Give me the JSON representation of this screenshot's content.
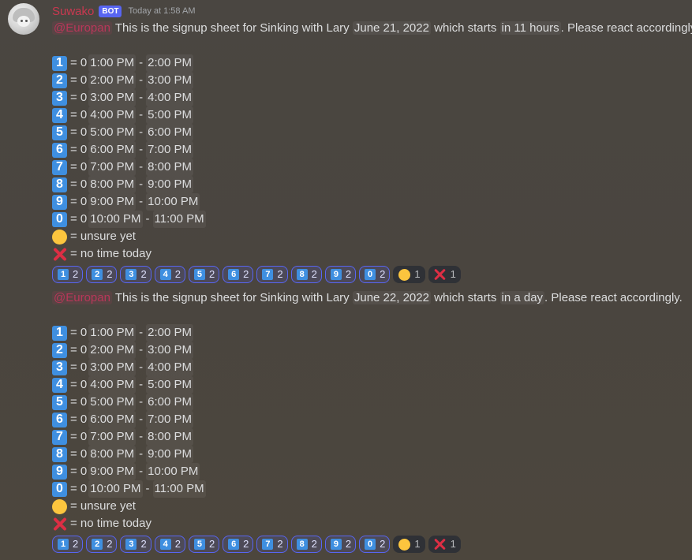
{
  "author": {
    "name": "Suwako",
    "tag": "BOT",
    "timestamp": "Today at 1:58 AM"
  },
  "messages": [
    {
      "mention": "@Europan",
      "intro": "This is the signup sheet for Sinking with Lary",
      "date": "June 21, 2022",
      "mid": "which starts",
      "relative": "in 11 hours",
      "outro": ". Please react accordingly.",
      "slots": [
        {
          "key": "1",
          "prefix": "= 0",
          "start": "1:00 PM",
          "sep": "-",
          "end": "2:00 PM"
        },
        {
          "key": "2",
          "prefix": "= 0",
          "start": "2:00 PM",
          "sep": "-",
          "end": "3:00 PM"
        },
        {
          "key": "3",
          "prefix": "= 0",
          "start": "3:00 PM",
          "sep": "-",
          "end": "4:00 PM"
        },
        {
          "key": "4",
          "prefix": "= 0",
          "start": "4:00 PM",
          "sep": "-",
          "end": "5:00 PM"
        },
        {
          "key": "5",
          "prefix": "= 0",
          "start": "5:00 PM",
          "sep": "-",
          "end": "6:00 PM"
        },
        {
          "key": "6",
          "prefix": "= 0",
          "start": "6:00 PM",
          "sep": "-",
          "end": "7:00 PM"
        },
        {
          "key": "7",
          "prefix": "= 0",
          "start": "7:00 PM",
          "sep": "-",
          "end": "8:00 PM"
        },
        {
          "key": "8",
          "prefix": "= 0",
          "start": "8:00 PM",
          "sep": "-",
          "end": "9:00 PM"
        },
        {
          "key": "9",
          "prefix": "= 0",
          "start": "9:00 PM",
          "sep": "-",
          "end": "10:00 PM"
        },
        {
          "key": "0",
          "prefix": "= 0",
          "start": "10:00 PM",
          "sep": "-",
          "end": "11:00 PM"
        }
      ],
      "unsure": "= unsure yet",
      "no_time": "= no time today",
      "reactions": [
        {
          "emoji": "1",
          "count": "2"
        },
        {
          "emoji": "2",
          "count": "2"
        },
        {
          "emoji": "3",
          "count": "2"
        },
        {
          "emoji": "4",
          "count": "2"
        },
        {
          "emoji": "5",
          "count": "2"
        },
        {
          "emoji": "6",
          "count": "2"
        },
        {
          "emoji": "7",
          "count": "2"
        },
        {
          "emoji": "8",
          "count": "2"
        },
        {
          "emoji": "9",
          "count": "2"
        },
        {
          "emoji": "0",
          "count": "2"
        },
        {
          "emoji": "yellow-circle",
          "count": "1"
        },
        {
          "emoji": "x",
          "count": "1"
        }
      ]
    },
    {
      "mention": "@Europan",
      "intro": "This is the signup sheet for Sinking with Lary",
      "date": "June 22, 2022",
      "mid": "which starts",
      "relative": "in a day",
      "outro": ". Please react accordingly.",
      "slots": [
        {
          "key": "1",
          "prefix": "= 0",
          "start": "1:00 PM",
          "sep": "-",
          "end": "2:00 PM"
        },
        {
          "key": "2",
          "prefix": "= 0",
          "start": "2:00 PM",
          "sep": "-",
          "end": "3:00 PM"
        },
        {
          "key": "3",
          "prefix": "= 0",
          "start": "3:00 PM",
          "sep": "-",
          "end": "4:00 PM"
        },
        {
          "key": "4",
          "prefix": "= 0",
          "start": "4:00 PM",
          "sep": "-",
          "end": "5:00 PM"
        },
        {
          "key": "5",
          "prefix": "= 0",
          "start": "5:00 PM",
          "sep": "-",
          "end": "6:00 PM"
        },
        {
          "key": "6",
          "prefix": "= 0",
          "start": "6:00 PM",
          "sep": "-",
          "end": "7:00 PM"
        },
        {
          "key": "7",
          "prefix": "= 0",
          "start": "7:00 PM",
          "sep": "-",
          "end": "8:00 PM"
        },
        {
          "key": "8",
          "prefix": "= 0",
          "start": "8:00 PM",
          "sep": "-",
          "end": "9:00 PM"
        },
        {
          "key": "9",
          "prefix": "= 0",
          "start": "9:00 PM",
          "sep": "-",
          "end": "10:00 PM"
        },
        {
          "key": "0",
          "prefix": "= 0",
          "start": "10:00 PM",
          "sep": "-",
          "end": "11:00 PM"
        }
      ],
      "unsure": "= unsure yet",
      "no_time": "= no time today",
      "reactions": [
        {
          "emoji": "1",
          "count": "2"
        },
        {
          "emoji": "2",
          "count": "2"
        },
        {
          "emoji": "3",
          "count": "2"
        },
        {
          "emoji": "4",
          "count": "2"
        },
        {
          "emoji": "5",
          "count": "2"
        },
        {
          "emoji": "6",
          "count": "2"
        },
        {
          "emoji": "7",
          "count": "2"
        },
        {
          "emoji": "8",
          "count": "2"
        },
        {
          "emoji": "9",
          "count": "2"
        },
        {
          "emoji": "0",
          "count": "2"
        },
        {
          "emoji": "yellow-circle",
          "count": "1"
        },
        {
          "emoji": "x",
          "count": "1"
        }
      ]
    }
  ]
}
